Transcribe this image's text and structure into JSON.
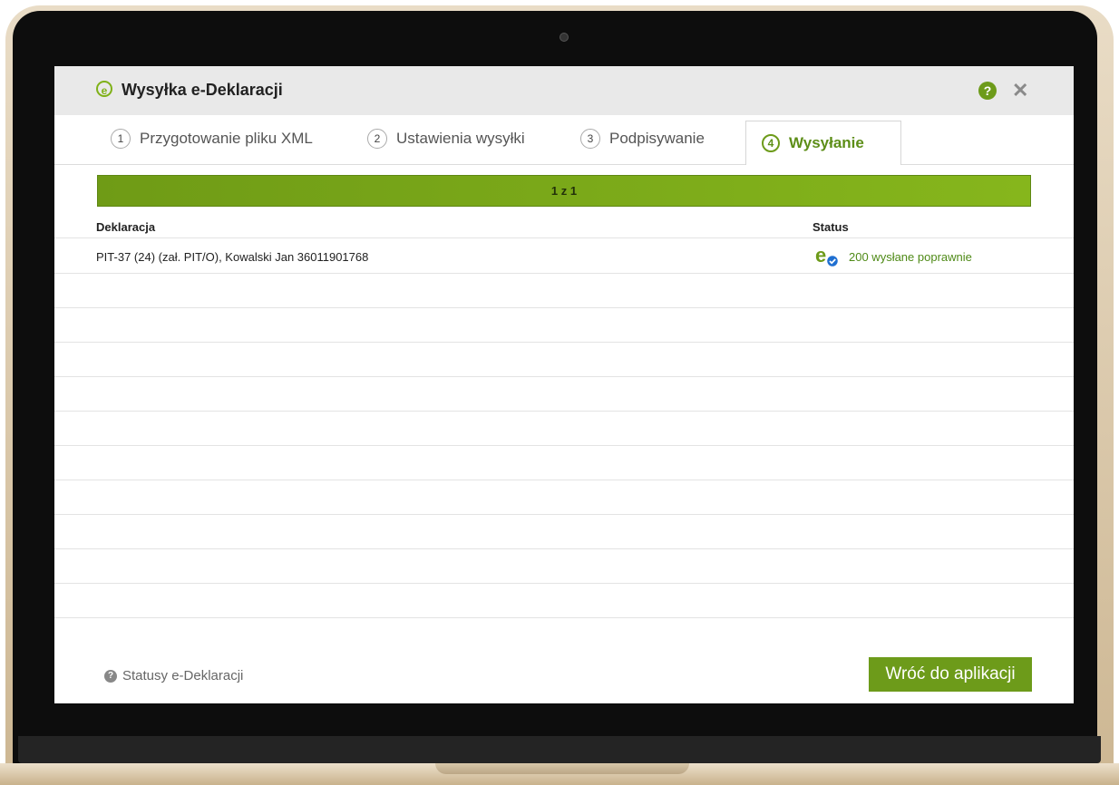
{
  "dialog": {
    "title": "Wysyłka e-Deklaracji",
    "logo_letter": "e"
  },
  "tabs": [
    {
      "num": "1",
      "label": "Przygotowanie pliku XML"
    },
    {
      "num": "2",
      "label": "Ustawienia wysyłki"
    },
    {
      "num": "3",
      "label": "Podpisywanie"
    },
    {
      "num": "4",
      "label": "Wysyłanie"
    }
  ],
  "progress": {
    "label": "1 z 1",
    "fraction": 1.0
  },
  "table": {
    "headers": {
      "declaration": "Deklaracja",
      "status": "Status"
    },
    "rows": [
      {
        "declaration": "PIT-37 (24) (zał. PIT/O), Kowalski Jan 36011901768",
        "status": "200 wysłane poprawnie"
      }
    ]
  },
  "footer": {
    "help_link": "Statusy e-Deklaracji",
    "back_button": "Wróć do aplikacji"
  },
  "icons": {
    "help": "help-icon",
    "close": "close-icon",
    "status": "e-sent-check-icon"
  },
  "colors": {
    "accent": "#6d9b1a",
    "status_text": "#4f8a17"
  }
}
